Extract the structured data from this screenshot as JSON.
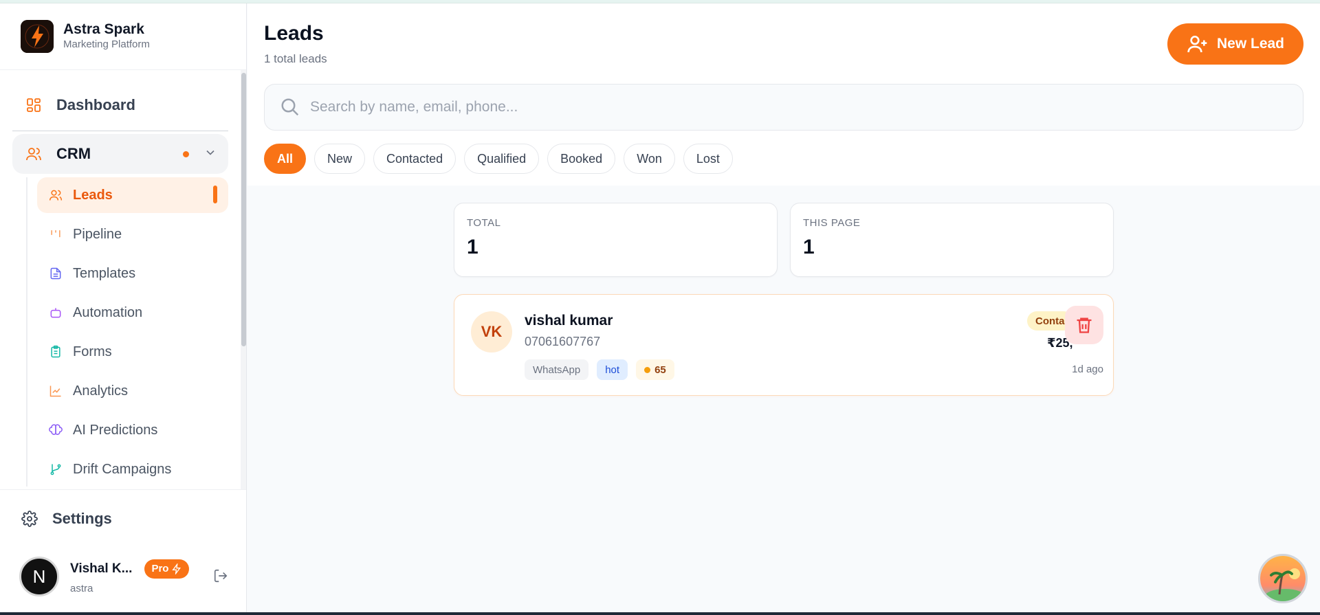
{
  "brand": {
    "name": "Astra Spark",
    "subtitle": "Marketing Platform"
  },
  "nav": {
    "dashboard": "Dashboard",
    "crm": "CRM",
    "sub_items": [
      {
        "label": "Leads",
        "icon": "users-icon",
        "color": "#f97316"
      },
      {
        "label": "Pipeline",
        "icon": "pipeline-icon",
        "color": "#f97316"
      },
      {
        "label": "Templates",
        "icon": "file-text-icon",
        "color": "#6366f1"
      },
      {
        "label": "Automation",
        "icon": "bot-icon",
        "color": "#a855f7"
      },
      {
        "label": "Forms",
        "icon": "clipboard-icon",
        "color": "#14b8a6"
      },
      {
        "label": "Analytics",
        "icon": "line-chart-icon",
        "color": "#f97316"
      },
      {
        "label": "AI Predictions",
        "icon": "brain-icon",
        "color": "#8b5cf6"
      },
      {
        "label": "Drift Campaigns",
        "icon": "git-branch-icon",
        "color": "#14b8a6"
      }
    ],
    "settings": "Settings"
  },
  "user": {
    "initial": "N",
    "name": "Vishal K...",
    "badge": "Pro",
    "role": "astra"
  },
  "header": {
    "title": "Leads",
    "subtitle": "1 total leads",
    "new_lead_label": "New Lead"
  },
  "search": {
    "placeholder": "Search by name, email, phone...",
    "value": ""
  },
  "filters": [
    "All",
    "New",
    "Contacted",
    "Qualified",
    "Booked",
    "Won",
    "Lost"
  ],
  "active_filter": "All",
  "stats": {
    "total": {
      "label": "TOTAL",
      "value": "1"
    },
    "this_page": {
      "label": "THIS PAGE",
      "value": "1"
    }
  },
  "lead": {
    "initials": "VK",
    "name": "vishal kumar",
    "phone": "07061607767",
    "source": "WhatsApp",
    "temperature": "hot",
    "score": "65",
    "status": "Conta",
    "amount": "₹25,",
    "time_ago": "1d ago"
  },
  "colors": {
    "accent": "#f97316",
    "accent_soft": "#fff1e6",
    "danger": "#ef4444"
  }
}
